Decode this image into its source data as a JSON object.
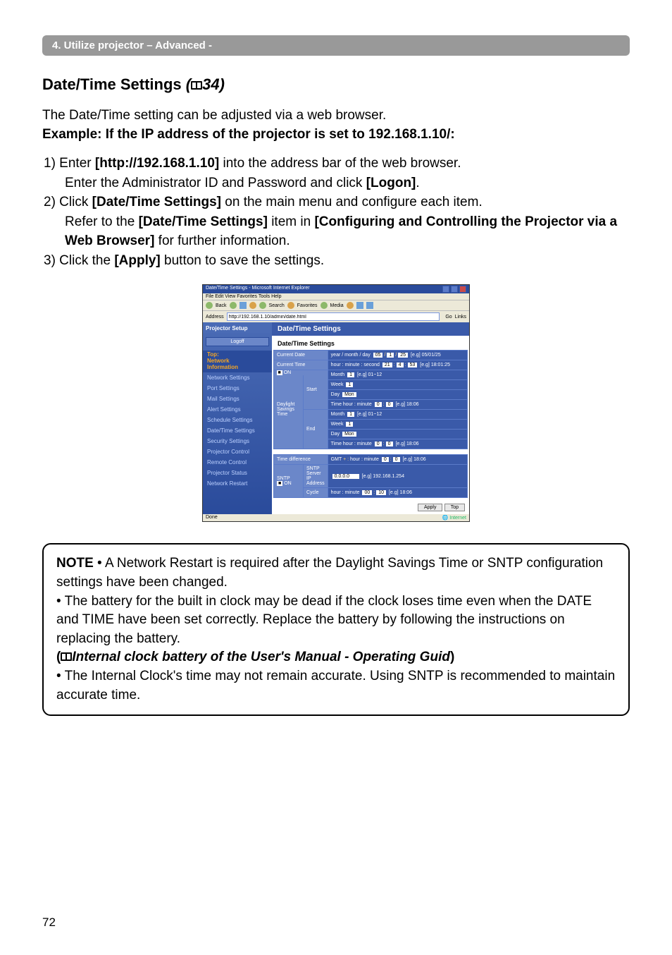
{
  "breadcrumb": "4. Utilize projector – Advanced -",
  "heading": {
    "title": "Date/Time Settings",
    "ref_open": "(",
    "ref_num": "34",
    "ref_close": ")"
  },
  "intro": {
    "line1": "The Date/Time setting can be adjusted via a web browser.",
    "line2": "Example: If the IP address of the projector is set to 192.168.1.10/:"
  },
  "steps": {
    "s1a_num": "1)",
    "s1a_pre": " Enter ",
    "s1a_b": "[http://192.168.1.10]",
    "s1a_post": " into the address bar of the web browser.",
    "s1b_pre": "Enter the Administrator ID and Password and click ",
    "s1b_b": "[Logon]",
    "s1b_post": ".",
    "s2a_num": "2)",
    "s2a_pre": " Click ",
    "s2a_b": "[Date/Time Settings]",
    "s2a_post": " on the main menu and configure each item.",
    "s2b_pre": "Refer to the ",
    "s2b_b1": "[Date/Time Settings]",
    "s2b_mid": " item in ",
    "s2b_b2": "[Configuring and Controlling the Projector via a Web Browser]",
    "s2b_post": " for further information.",
    "s3_num": "3)",
    "s3_pre": " Click the ",
    "s3_b": "[Apply]",
    "s3_post": " button to save the settings."
  },
  "screenshot": {
    "window_title": "Date/Time Settings - Microsoft Internet Explorer",
    "menubar": "File   Edit   View   Favorites   Tools   Help",
    "toolbar": {
      "back": "Back",
      "search": "Search",
      "favorites": "Favorites",
      "media": "Media"
    },
    "address_label": "Address",
    "address_value": "http://192.168.1.10/admin/date.html",
    "go": "Go",
    "links": "Links",
    "sidebar": {
      "brand": "Projector Setup",
      "logoff": "Logoff",
      "section": "Top:\nNetwork\nInformation",
      "items": [
        "Network Settings",
        "Port Settings",
        "Mail Settings",
        "Alert Settings",
        "Schedule Settings",
        "Date/Time Settings",
        "Security Settings",
        "Projector Control",
        "Remote Control",
        "Projector Status",
        "Network Restart"
      ]
    },
    "main": {
      "title": "Date/Time Settings",
      "subtitle": "Date/Time Settings",
      "rows": {
        "current_date": {
          "label": "Current Date",
          "value": "year / month / day",
          "ex": "[e.g] 05/01/25",
          "f1": "05",
          "f2": "1",
          "f3": "25"
        },
        "current_time": {
          "label": "Current Time",
          "value": "hour : minute : second",
          "ex": "[e.g] 18:01:25",
          "f1": "21",
          "f2": "4",
          "f3": "53"
        },
        "dst": {
          "label": "Daylight Savings Time",
          "on": "ON"
        },
        "dst_start": {
          "label": "Start",
          "month": "Month",
          "month_v": "1",
          "month_ex": "[e.g] 01~12",
          "week": "Week",
          "week_v": "1",
          "day": "Day",
          "day_v": "Mon",
          "time": "Time  hour : minute",
          "time_h": "0",
          "time_m": "0",
          "time_ex": "[e.g] 18:06"
        },
        "dst_end": {
          "label": "End",
          "month": "Month",
          "month_v": "1",
          "month_ex": "[e.g] 01~12",
          "week": "Week",
          "week_v": "1",
          "day": "Day",
          "day_v": "Mon",
          "time": "Time  hour : minute",
          "time_h": "0",
          "time_m": "0",
          "time_ex": "[e.g] 18:06"
        },
        "time_diff": {
          "label": "Time difference",
          "gmt": "GMT",
          "sign": "+ :",
          "hm": "hour : minute",
          "h": "0",
          "m": "0",
          "ex": "[e.g] 18:06"
        },
        "sntp": {
          "label": "SNTP",
          "ip_label": "SNTP Server IP Address",
          "ip": "0.0.0.0",
          "ip_ex": "[e.g] 192.168.1.254",
          "on": "ON",
          "cycle_label": "Cycle",
          "cycle": "hour : minute",
          "ch": "00",
          "cm": "10",
          "cex": "[e.g] 18:06"
        }
      },
      "apply": "Apply",
      "top": "Top"
    },
    "status_done": "Done",
    "status_inet": "Internet"
  },
  "note": {
    "head": "NOTE",
    "l1": "  • A Network Restart is required after the Daylight Savings Time or SNTP configuration settings have been changed.",
    "l2": "• The battery for the built in clock may be dead if the clock loses time even when the DATE and TIME have been set correctly. Replace the battery by following the instructions on replacing the battery.",
    "ref_open": "(",
    "ref_text": "Internal clock battery of the User's Manual - Operating Guid",
    "ref_close": ")",
    "l3": "• The Internal Clock's time may not remain accurate. Using SNTP is recommended to maintain accurate time."
  },
  "page_number": "72"
}
